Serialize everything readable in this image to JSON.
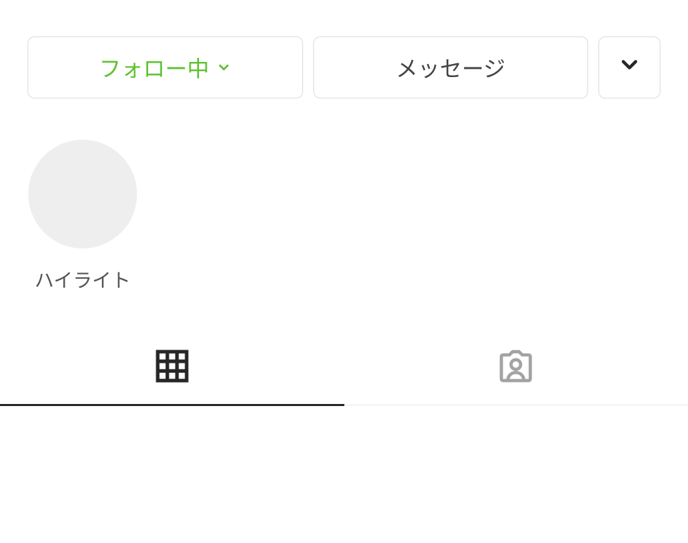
{
  "buttons": {
    "following_label": "フォロー中",
    "message_label": "メッセージ"
  },
  "highlights": {
    "items": [
      {
        "label": "ハイライト"
      }
    ]
  },
  "tabs": {
    "grid_active": true,
    "tagged_active": false
  },
  "colors": {
    "accent_green": "#5cc22e",
    "border": "#dbdbdb",
    "text_primary": "#262626",
    "text_secondary": "#555555",
    "placeholder_circle": "#eeeeee",
    "inactive_icon": "#a3a3a3"
  }
}
